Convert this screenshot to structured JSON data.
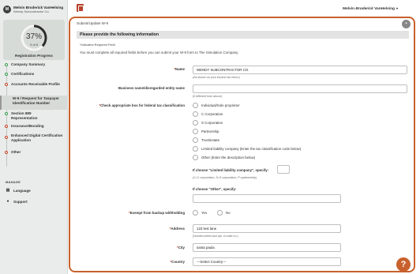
{
  "user": {
    "initial": "M",
    "name": "Melvin Broderick VanHelsing",
    "company": "Wendy Subcontractor Co."
  },
  "progress": {
    "percent_label": "37%",
    "count_label": "3 of 8",
    "label": "Registration Progress",
    "value": 0.37
  },
  "steps": [
    {
      "label": "Company Summary",
      "status": "complete"
    },
    {
      "label": "Certifications",
      "status": "complete"
    },
    {
      "label": "Accounts Receivable Profile",
      "status": "incomplete"
    },
    {
      "label": "W-9 / Request for Taxpayer Identification Number",
      "status": "active"
    },
    {
      "label": "Section 889 Representation",
      "status": "complete"
    },
    {
      "label": "Insurance/Bonding",
      "status": "incomplete"
    },
    {
      "label": "Enhanced Digital Certification Application",
      "status": "incomplete"
    },
    {
      "label": "Other",
      "status": "incomplete"
    }
  ],
  "manage": {
    "heading": "MANAGE",
    "language": "Language",
    "support": "Support"
  },
  "topbar": {
    "user_first": "Melvin ",
    "user_middle": "Broderick",
    "user_last": " VanHelsing"
  },
  "form": {
    "breadcrumb": "Submit/Update W-9",
    "section_title": "Please provide the following information",
    "required_note": "*Indicates Required Field",
    "instructions": "You must complete all required fields before you can submit your W-9 form to The Simulation Company.",
    "name_label": "Name",
    "name_value": "WENDY SUBCONTRACTOR CO.",
    "name_hint": "(As shown on your income tax return)",
    "business_label": "Business name/disregarded entity name",
    "business_value": "",
    "business_hint": "(If different from above)",
    "classification_label": "Check appropriate box for federal tax classification",
    "classification_options": [
      "Individual/Sole proprietor",
      "C Corporation",
      "S Corporation",
      "Partnership",
      "Trust/estate",
      "Limited liability company (Enter the tax classification code below)",
      "Other (Enter the description below)"
    ],
    "llc_label": "If choose \"Limited liability company\", specify:",
    "llc_hint": "(C=C corporation, S=S corporation, P=partnership)",
    "other_label": "If choose \"Other\", specify:",
    "exempt_label": "Exempt from backup withholding",
    "exempt_yes": "Yes",
    "exempt_no": "No",
    "address_label": "Address",
    "address_value": "123 test lane",
    "address_hint": "(Number,street,and apt. or suite no.)",
    "city_label": "City",
    "city_value": "santa paula",
    "country_label": "Country",
    "country_value": "---Select Country---"
  },
  "help": {
    "symbol": "?"
  },
  "close": {
    "symbol": "▪"
  },
  "colors": {
    "accent": "#c8612d",
    "complete": "#3a9b4f",
    "incomplete": "#c9452b",
    "required": "#c0392b"
  }
}
